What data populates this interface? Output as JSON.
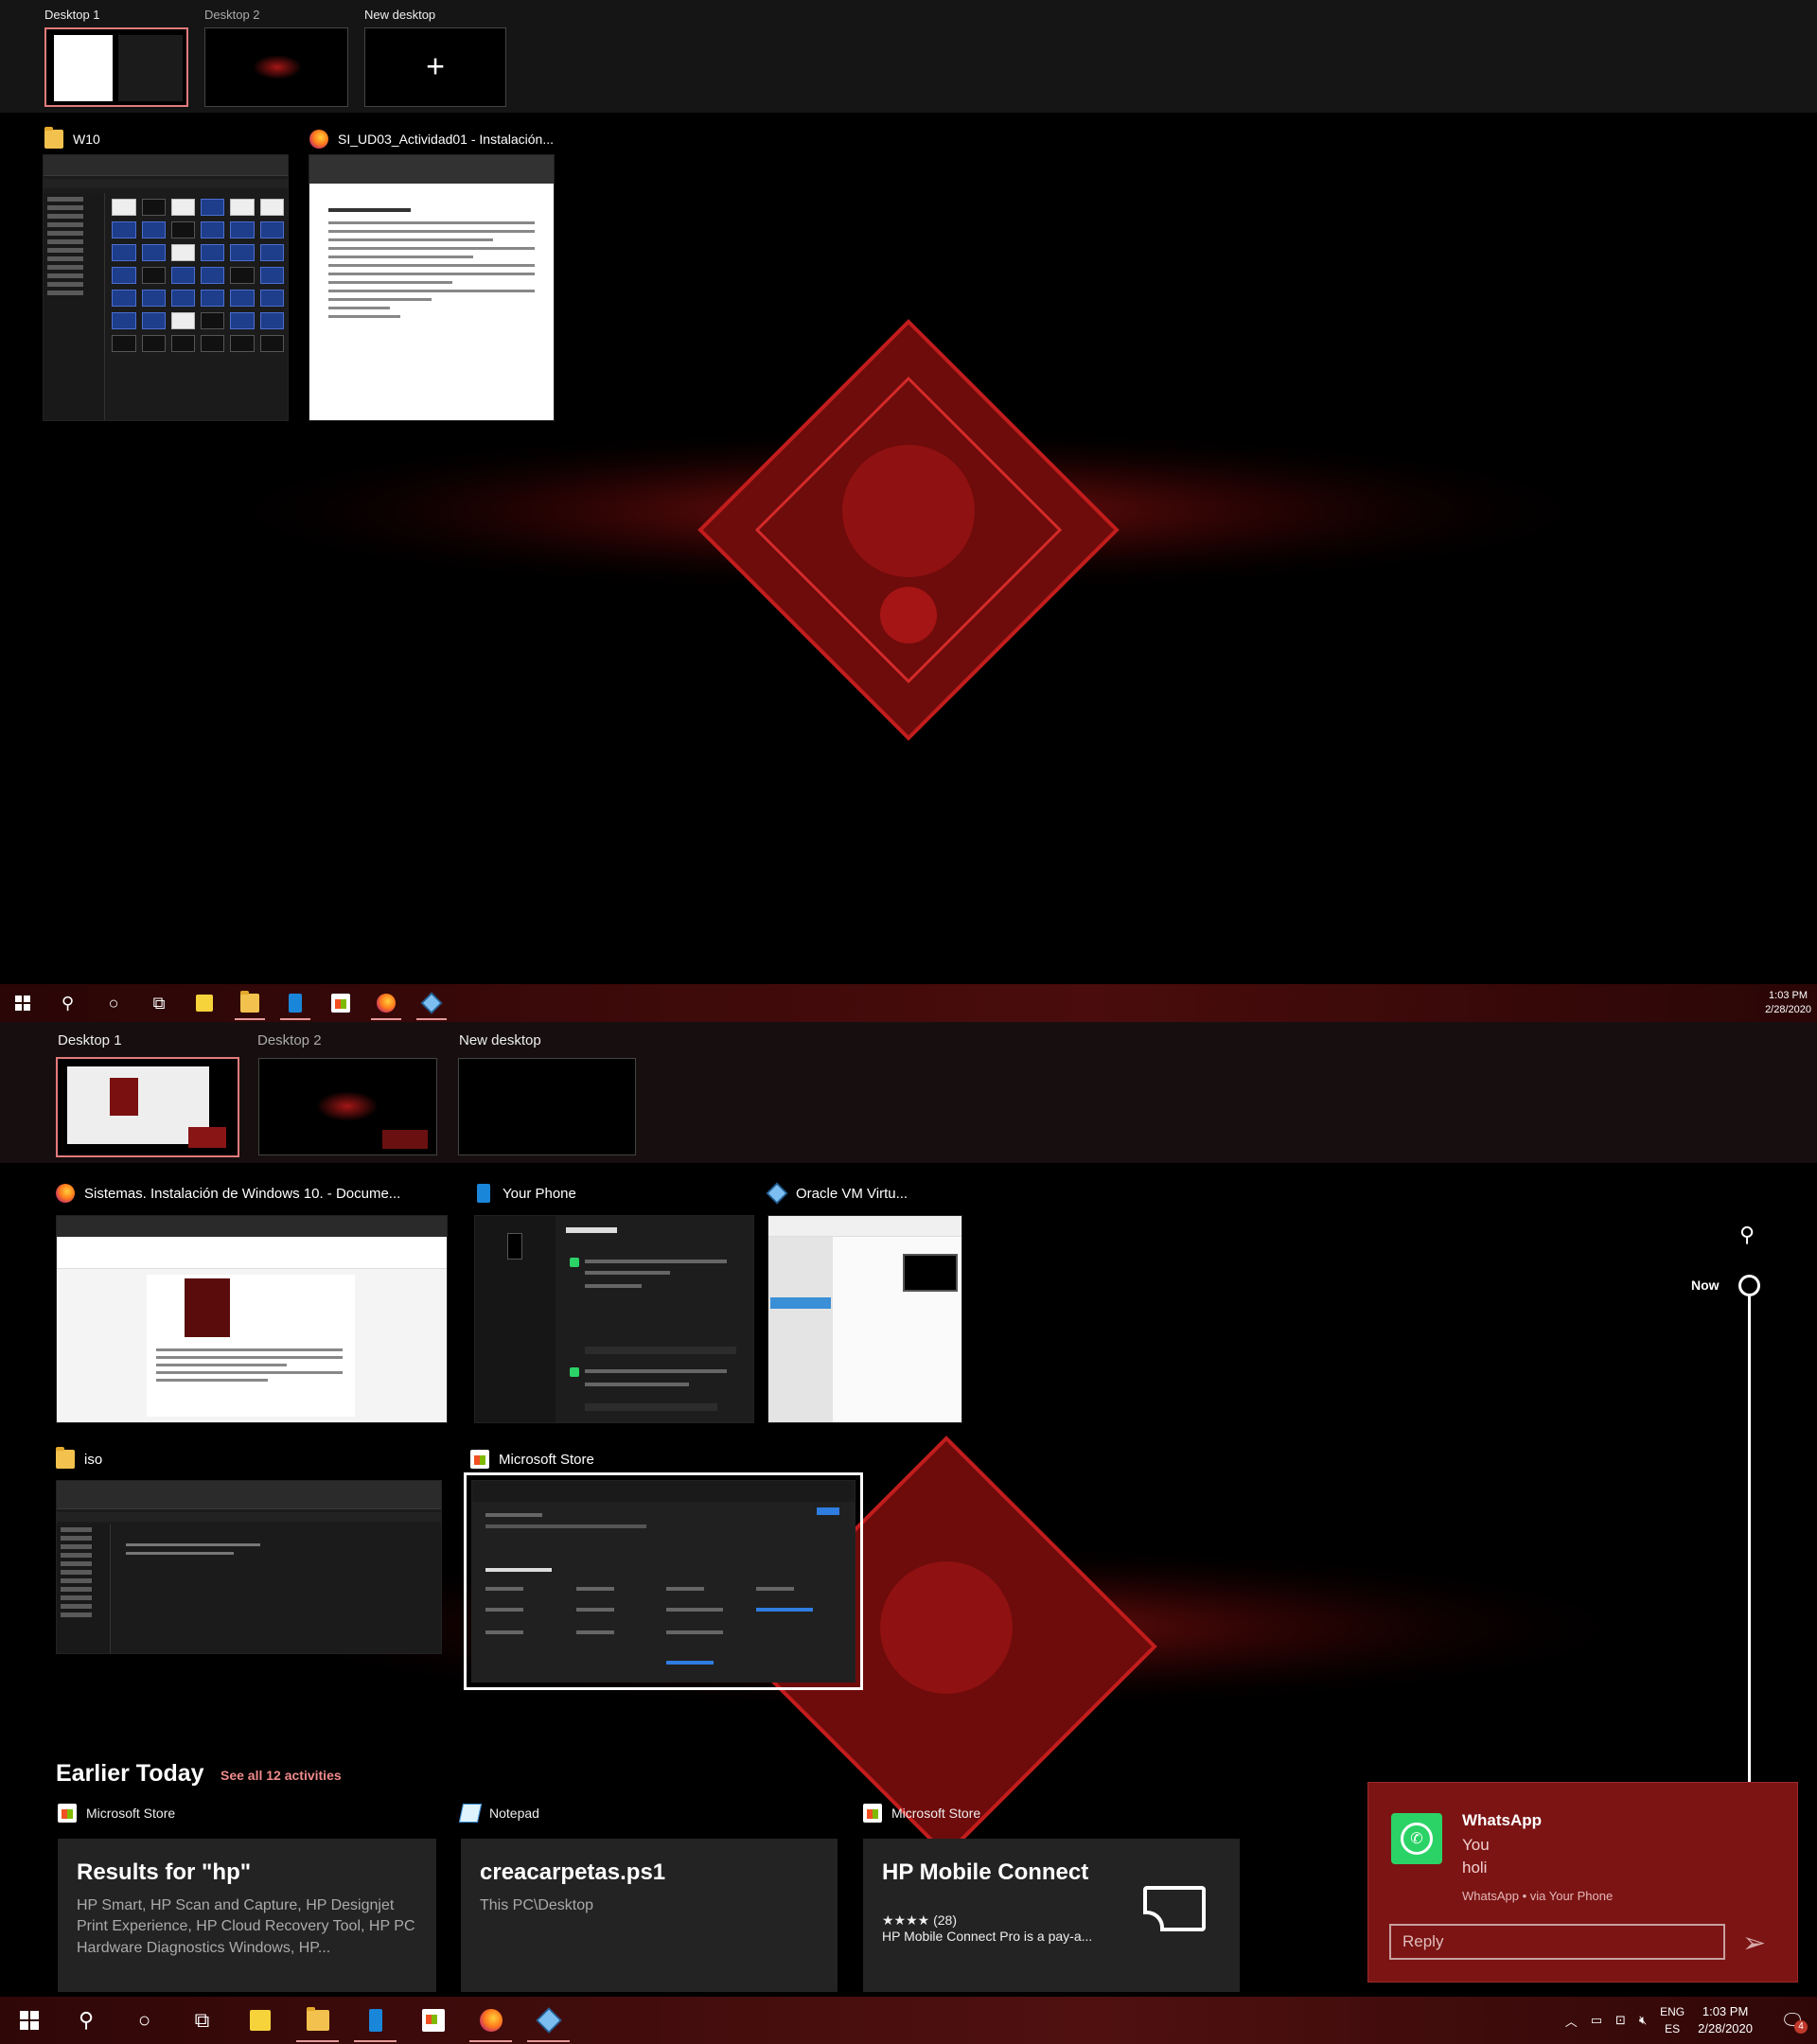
{
  "screen1": {
    "desktops": [
      {
        "label": "Desktop 1"
      },
      {
        "label": "Desktop 2"
      },
      {
        "label": "New desktop"
      }
    ],
    "windows": [
      {
        "title": "W10",
        "icon": "folder-icon"
      },
      {
        "title": "SI_UD03_Actividad01 - Instalación...",
        "icon": "firefox-icon"
      }
    ],
    "taskbar": {
      "time": "1:03 PM",
      "date": "2/28/2020"
    }
  },
  "screen2": {
    "desktops": [
      {
        "label": "Desktop 1"
      },
      {
        "label": "Desktop 2"
      },
      {
        "label": "New desktop"
      }
    ],
    "windows": [
      {
        "title": "Sistemas. Instalación de Windows 10. - Docume...",
        "icon": "firefox-icon"
      },
      {
        "title": "Your Phone",
        "icon": "phone-icon"
      },
      {
        "title": "Oracle VM Virtu...",
        "icon": "vbox-icon"
      },
      {
        "title": "iso",
        "icon": "folder-icon"
      },
      {
        "title": "Microsoft Store",
        "icon": "store-icon"
      }
    ],
    "timeline": {
      "now_label": "Now",
      "section_title": "Earlier Today",
      "see_all": "See all 12 activities",
      "activities": [
        {
          "app": "Microsoft Store",
          "title": "Results for \"hp\"",
          "subtitle": "HP Smart, HP Scan and Capture, HP Designjet Print Experience, HP Cloud Recovery Tool, HP PC Hardware Diagnostics Windows, HP..."
        },
        {
          "app": "Notepad",
          "title": "creacarpetas.ps1",
          "subtitle": "This PC\\Desktop"
        },
        {
          "app": "Microsoft Store",
          "title": "HP Mobile Connect",
          "rating": "★★★★ (28)",
          "description": "HP Mobile Connect Pro is a pay-a..."
        }
      ]
    },
    "toast": {
      "app": "WhatsApp",
      "line1": "You",
      "line2": "holi",
      "meta": "WhatsApp • via Your Phone",
      "reply_placeholder": "Reply"
    },
    "taskbar": {
      "lang_top": "ENG",
      "lang_bottom": "ES",
      "time": "1:03 PM",
      "date": "2/28/2020",
      "notification_count": "4"
    }
  },
  "colors": {
    "accent": "#e37b7b",
    "taskbar": "#3c0808",
    "toast": "#7c1414",
    "link": "#f08a8a"
  }
}
